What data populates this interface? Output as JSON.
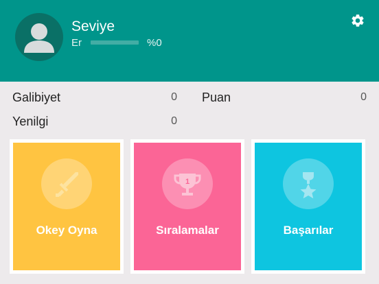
{
  "profile": {
    "title": "Seviye",
    "rank": "Er",
    "progress_percent": 0,
    "progress_label": "%0"
  },
  "stats": {
    "wins_label": "Galibiyet",
    "wins_value": "0",
    "points_label": "Puan",
    "points_value": "0",
    "losses_label": "Yenilgi",
    "losses_value": "0"
  },
  "cards": [
    {
      "label": "Okey Oyna",
      "icon": "sword-icon",
      "color": "#ffc441"
    },
    {
      "label": "Sıralamalar",
      "icon": "trophy-icon",
      "color": "#fb6596"
    },
    {
      "label": "Başarılar",
      "icon": "star-trophy-icon",
      "color": "#0ec5e0"
    }
  ],
  "colors": {
    "header": "#00958b",
    "background": "#edeaec"
  },
  "icons": {
    "settings": "gear-icon",
    "avatar": "user-avatar-icon"
  }
}
